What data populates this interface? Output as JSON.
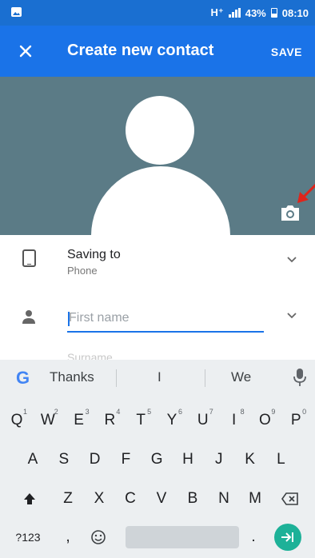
{
  "status_bar": {
    "network": "H⁺",
    "battery_percent": "43%",
    "time": "08:10"
  },
  "app_bar": {
    "close_icon": "close-icon",
    "title": "Create new contact",
    "save_label": "SAVE"
  },
  "photo": {
    "avatar": "person-silhouette",
    "camera_icon": "camera-icon",
    "annotation": "red-arrow"
  },
  "form": {
    "saving_to": {
      "label": "Saving to",
      "value": "Phone",
      "icon": "phone-icon"
    },
    "first_name": {
      "placeholder": "First name",
      "value": "",
      "icon": "person-icon"
    },
    "surname": {
      "placeholder": "Surname"
    }
  },
  "keyboard": {
    "suggestions": [
      "Thanks",
      "I",
      "We"
    ],
    "row1": [
      {
        "key": "Q",
        "hint": "1"
      },
      {
        "key": "W",
        "hint": "2"
      },
      {
        "key": "E",
        "hint": "3"
      },
      {
        "key": "R",
        "hint": "4"
      },
      {
        "key": "T",
        "hint": "5"
      },
      {
        "key": "Y",
        "hint": "6"
      },
      {
        "key": "U",
        "hint": "7"
      },
      {
        "key": "I",
        "hint": "8"
      },
      {
        "key": "O",
        "hint": "9"
      },
      {
        "key": "P",
        "hint": "0"
      }
    ],
    "row2": [
      "A",
      "S",
      "D",
      "F",
      "G",
      "H",
      "J",
      "K",
      "L"
    ],
    "row3": [
      "Z",
      "X",
      "C",
      "V",
      "B",
      "N",
      "M"
    ],
    "symbols_label": "?123",
    "comma": ",",
    "period": ".",
    "colors": {
      "background": "#eceff1",
      "enter_key": "#1db198"
    }
  },
  "colors": {
    "app_bar": "#1a73e8",
    "photo_background": "#5b7b86",
    "accent": "#1a73e8"
  }
}
